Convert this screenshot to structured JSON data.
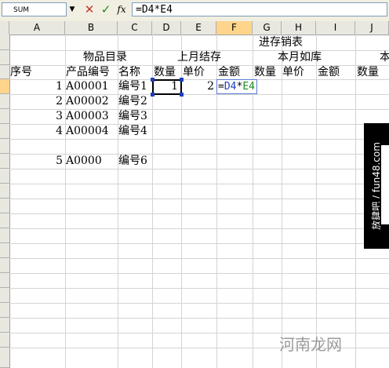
{
  "formula_bar": {
    "name_box": "SUM",
    "name_box_arrow": "▼",
    "cancel_icon": "✕",
    "enter_icon": "✓",
    "function_icon": "fx",
    "formula": "=D4*E4"
  },
  "columns": [
    "A",
    "B",
    "C",
    "D",
    "E",
    "F",
    "G",
    "H",
    "I",
    "J"
  ],
  "rows": {
    "r1": {
      "title": "进存销表"
    },
    "r2": {
      "group1": "物品目录",
      "group2": "上月结存",
      "group3": "本月如库",
      "group4": "本"
    },
    "r3": {
      "a": "序号",
      "b": "产品编号",
      "c": "名称",
      "d": "数量",
      "e": "单价",
      "f": "金额",
      "g": "数量",
      "h": "单价",
      "i": "金额",
      "j": "数量"
    },
    "r4": {
      "a": "1",
      "b": "A00001",
      "c": "编号1",
      "d": "1",
      "e": "2",
      "f_edit": "=D4*E4",
      "f_part1": "=",
      "f_part2": "D4",
      "f_part3": "*",
      "f_part4": "E4"
    },
    "r5": {
      "a": "2",
      "b": "A00002",
      "c": "编号2"
    },
    "r6": {
      "a": "3",
      "b": "A00003",
      "c": "编号3"
    },
    "r7": {
      "a": "4",
      "b": "A00004",
      "c": "编号4"
    },
    "r9": {
      "a": "5",
      "b": "A0000",
      "c": "编号6"
    }
  },
  "side_panel": {
    "text": "放肆吧 / fun48.com"
  },
  "watermark": "河南龙网"
}
